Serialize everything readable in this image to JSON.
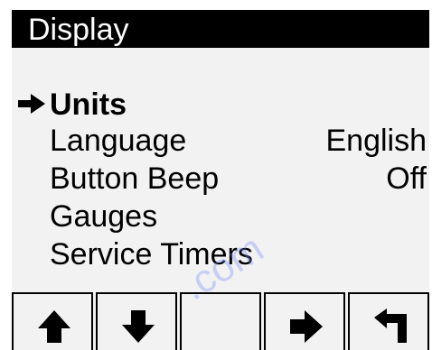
{
  "screen": {
    "title": "Display"
  },
  "menu": {
    "items": [
      {
        "label": "Units",
        "value": "",
        "selected": true
      },
      {
        "label": "Language",
        "value": "English",
        "selected": false
      },
      {
        "label": "Button Beep",
        "value": "Off",
        "selected": false
      },
      {
        "label": "Gauges",
        "value": "",
        "selected": false
      },
      {
        "label": "Service Timers",
        "value": "",
        "selected": false
      }
    ]
  },
  "softkeys": [
    {
      "icon": "arrow-up-icon"
    },
    {
      "icon": "arrow-down-icon"
    },
    {
      "icon": "blank"
    },
    {
      "icon": "arrow-right-icon"
    },
    {
      "icon": "return-icon"
    }
  ],
  "watermark": {
    "text": ".com"
  },
  "colors": {
    "background": "#f2f2f2",
    "titlebar": "#000000",
    "text": "#000000"
  }
}
